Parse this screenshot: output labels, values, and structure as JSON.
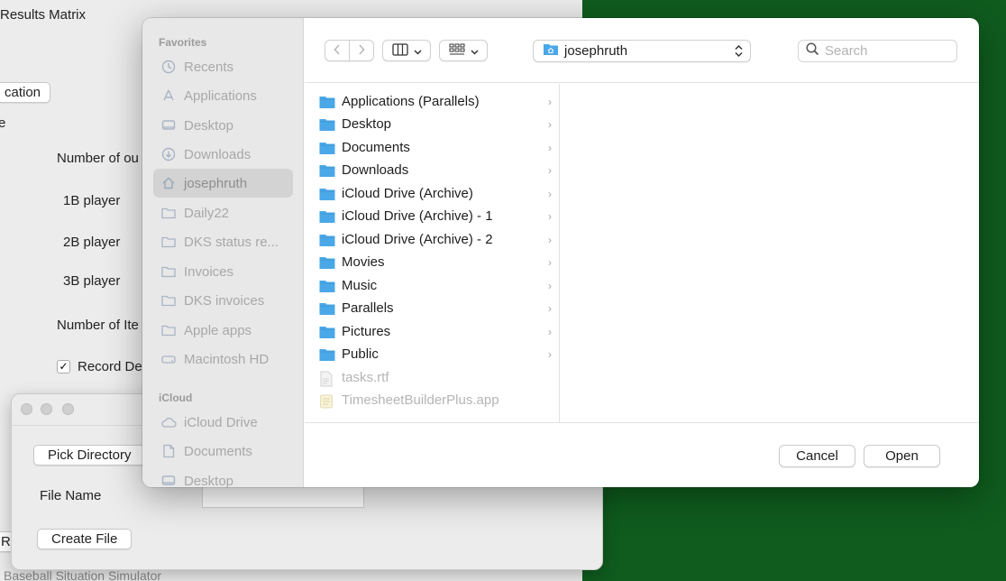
{
  "background_app": {
    "title": "Results Matrix",
    "location_button": "cation",
    "fragment_e": "e",
    "number_of_outs": "Number of ou",
    "player_1b": "1B player",
    "player_2b": "2B player",
    "player_3b": "3B player",
    "number_of_iterations": "Number of Ite",
    "record_checkbox": "Record De",
    "record_checked": true,
    "left_fragment": "R",
    "footer": "Baseball Situation Simulator"
  },
  "small_window": {
    "pick_directory": "Pick Directory",
    "file_name_label": "File Name",
    "create_file": "Create File"
  },
  "dialog": {
    "sidebar": {
      "favorites_label": "Favorites",
      "favorites": [
        {
          "label": "Recents",
          "icon": "clock-icon"
        },
        {
          "label": "Applications",
          "icon": "applications-icon"
        },
        {
          "label": "Desktop",
          "icon": "desktop-icon"
        },
        {
          "label": "Downloads",
          "icon": "download-icon"
        },
        {
          "label": "josephruth",
          "icon": "home-icon",
          "selected": true
        },
        {
          "label": "Daily22",
          "icon": "folder-icon"
        },
        {
          "label": "DKS status re...",
          "icon": "folder-icon"
        },
        {
          "label": "Invoices",
          "icon": "folder-icon"
        },
        {
          "label": "DKS invoices",
          "icon": "folder-icon"
        },
        {
          "label": "Apple apps",
          "icon": "folder-icon"
        },
        {
          "label": "Macintosh HD",
          "icon": "drive-icon"
        }
      ],
      "icloud_label": "iCloud",
      "icloud": [
        {
          "label": "iCloud Drive",
          "icon": "cloud-icon"
        },
        {
          "label": "Documents",
          "icon": "document-icon"
        },
        {
          "label": "Desktop",
          "icon": "desktop-icon"
        }
      ]
    },
    "toolbar": {
      "back_icon": "chevron-left-icon",
      "forward_icon": "chevron-right-icon",
      "view_icon": "columns-view-icon",
      "group_icon": "grid-icon",
      "location": "josephruth",
      "search_placeholder": "Search"
    },
    "files": [
      {
        "name": "Applications (Parallels)",
        "kind": "folder",
        "enabled": true
      },
      {
        "name": "Desktop",
        "kind": "folder",
        "enabled": true
      },
      {
        "name": "Documents",
        "kind": "folder",
        "enabled": true
      },
      {
        "name": "Downloads",
        "kind": "folder",
        "enabled": true
      },
      {
        "name": "iCloud Drive (Archive)",
        "kind": "folder",
        "enabled": true
      },
      {
        "name": "iCloud Drive (Archive) - 1",
        "kind": "folder",
        "enabled": true
      },
      {
        "name": "iCloud Drive (Archive) - 2",
        "kind": "folder",
        "enabled": true
      },
      {
        "name": "Movies",
        "kind": "folder",
        "enabled": true
      },
      {
        "name": "Music",
        "kind": "folder",
        "enabled": true
      },
      {
        "name": "Parallels",
        "kind": "folder",
        "enabled": true
      },
      {
        "name": "Pictures",
        "kind": "folder",
        "enabled": true
      },
      {
        "name": "Public",
        "kind": "folder",
        "enabled": true
      },
      {
        "name": "tasks.rtf",
        "kind": "file",
        "enabled": false
      },
      {
        "name": "TimesheetBuilderPlus.app",
        "kind": "app",
        "enabled": false
      }
    ],
    "cancel": "Cancel",
    "open": "Open"
  },
  "colors": {
    "folder_blue": "#4aa8e8",
    "background_green": "#0f5c1e"
  }
}
